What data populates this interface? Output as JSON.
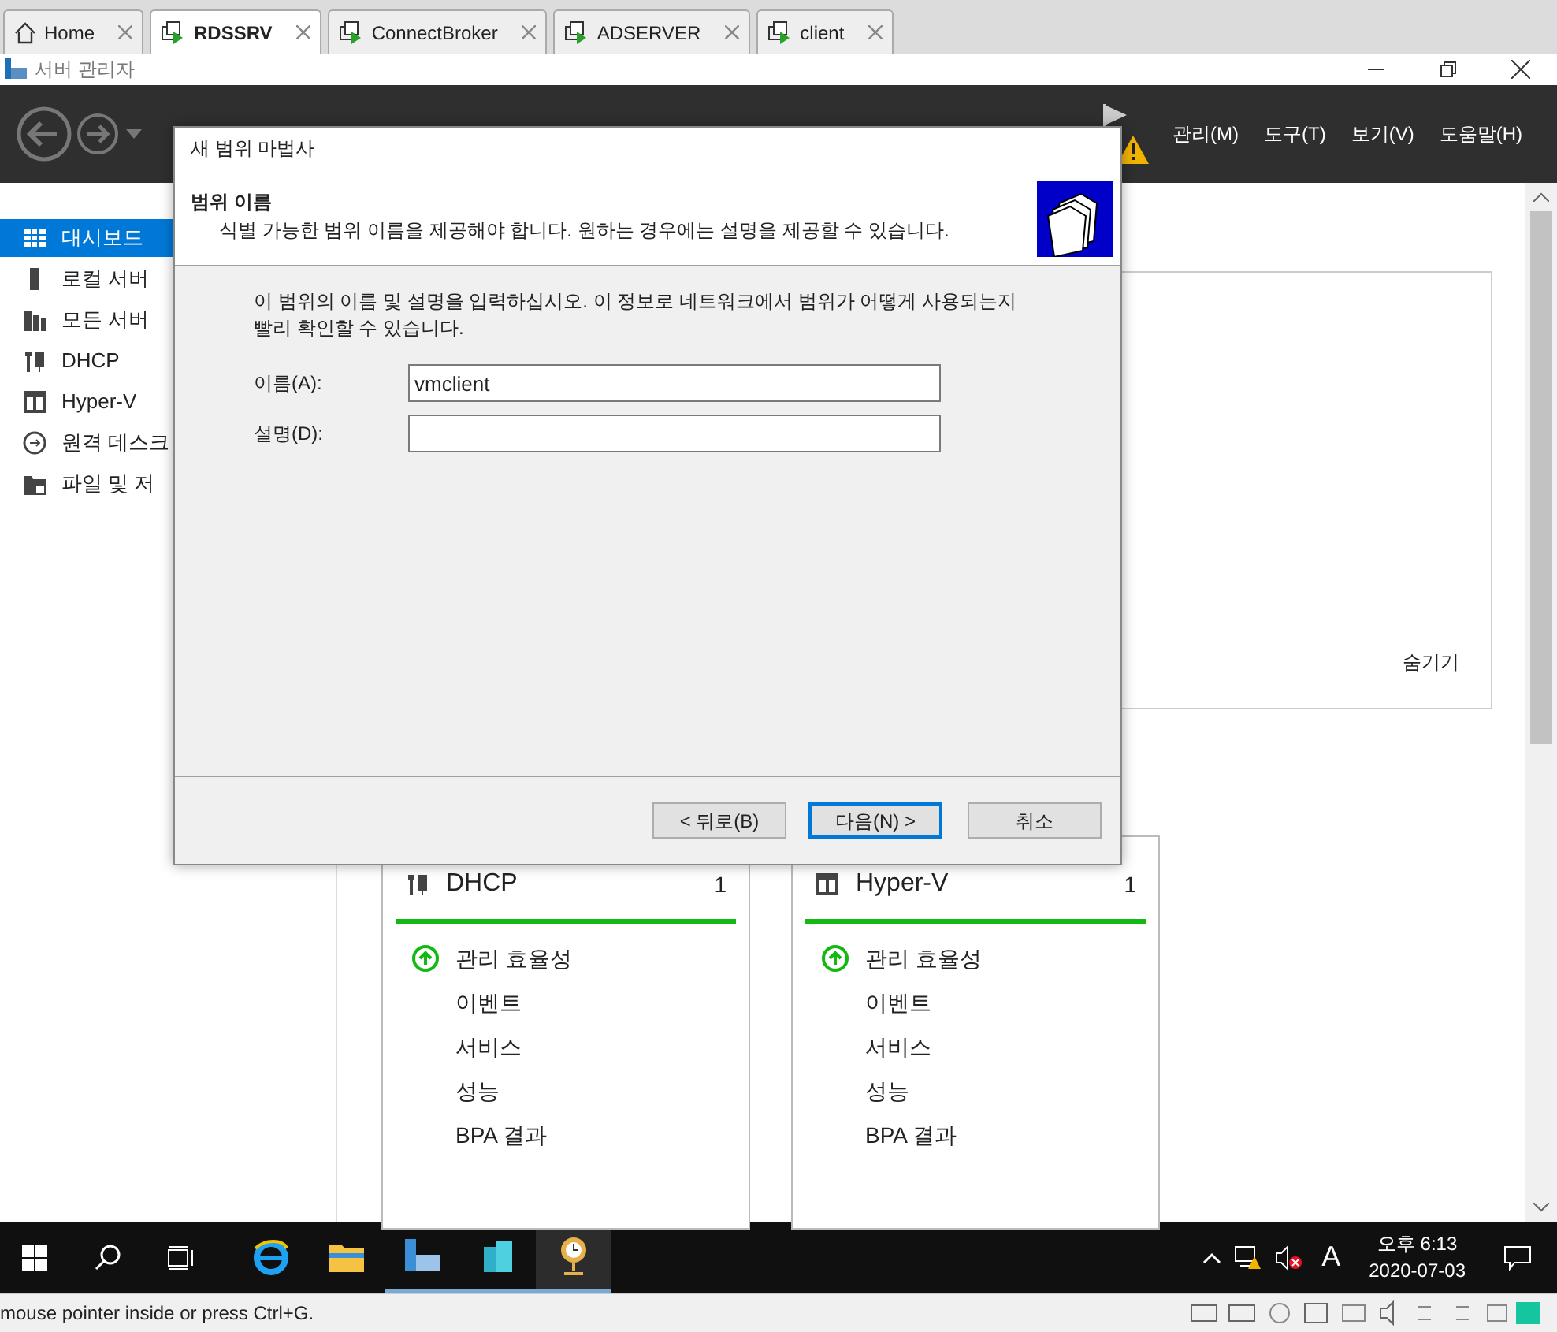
{
  "vm_tabs": [
    {
      "label": "Home",
      "kind": "home",
      "selected": false
    },
    {
      "label": "RDSSRV",
      "kind": "vm",
      "selected": true
    },
    {
      "label": "ConnectBroker",
      "kind": "vm",
      "selected": false
    },
    {
      "label": "ADSERVER",
      "kind": "vm",
      "selected": false
    },
    {
      "label": "client",
      "kind": "vm",
      "selected": false
    }
  ],
  "window": {
    "title": "서버 관리자"
  },
  "menu": [
    "관리(M)",
    "도구(T)",
    "보기(V)",
    "도움말(H)"
  ],
  "sidebar": {
    "items": [
      {
        "label": "대시보드",
        "kind": "dashboard",
        "selected": true
      },
      {
        "label": "로컬 서버",
        "kind": "local",
        "selected": false
      },
      {
        "label": "모든 서버",
        "kind": "all",
        "selected": false
      },
      {
        "label": "DHCP",
        "kind": "dhcp",
        "selected": false
      },
      {
        "label": "Hyper-V",
        "kind": "hyperv",
        "selected": false
      },
      {
        "label": "원격 데스크",
        "kind": "remote",
        "selected": false
      },
      {
        "label": "파일 및 저",
        "kind": "files",
        "selected": false
      }
    ]
  },
  "welcome_panel": {
    "hide_link": "숨기기"
  },
  "role_cards": [
    {
      "title": "DHCP",
      "kind": "dhcp",
      "count": "1",
      "items": [
        "관리 효율성",
        "이벤트",
        "서비스",
        "성능",
        "BPA 결과"
      ]
    },
    {
      "title": "Hyper-V",
      "kind": "hyperv",
      "count": "1",
      "items": [
        "관리 효율성",
        "이벤트",
        "서비스",
        "성능",
        "BPA 결과"
      ]
    }
  ],
  "dialog": {
    "title": "새 범위 마법사",
    "heading": "범위 이름",
    "subtitle": "식별 가능한 범위 이름을 제공해야 합니다. 원하는 경우에는 설명을 제공할 수 있습니다.",
    "intro": "이 범위의 이름 및 설명을 입력하십시오. 이 정보로 네트워크에서 범위가 어떻게 사용되는지 빨리 확인할 수 있습니다.",
    "fields": [
      {
        "label": "이름(A):",
        "value": "vmclient"
      },
      {
        "label": "설명(D):"
      }
    ],
    "buttons": [
      {
        "label": "< 뒤로(B)",
        "selected": false
      },
      {
        "label": "다음(N) >",
        "selected": true
      },
      {
        "label": "취소",
        "selected": false
      }
    ]
  },
  "taskbar": {
    "time": "오후 6:13",
    "date": "2020-07-03",
    "ime": "A"
  },
  "status_bar": {
    "text": "mouse pointer inside or press Ctrl+G."
  }
}
